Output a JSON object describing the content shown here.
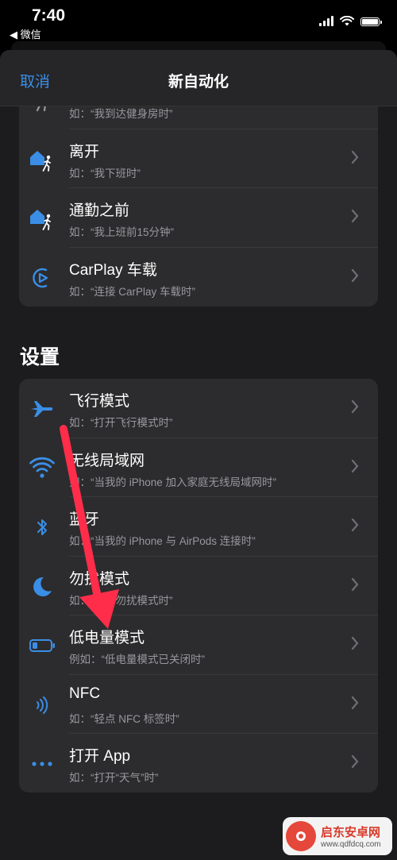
{
  "status": {
    "time": "7:40",
    "back_label": "◀ 微信"
  },
  "nav": {
    "cancel": "取消",
    "title": "新自动化"
  },
  "top_group": [
    {
      "title": "",
      "subtitle": "如：“我到达健身房时”",
      "icon": "person-walking-icon"
    },
    {
      "title": "离开",
      "subtitle": "如：“我下班时”",
      "icon": "house-person-leave-icon"
    },
    {
      "title": "通勤之前",
      "subtitle": "如：“我上班前15分钟”",
      "icon": "house-person-commute-icon"
    },
    {
      "title": "CarPlay 车载",
      "subtitle": "如：“连接 CarPlay 车载时”",
      "icon": "carplay-icon"
    }
  ],
  "settings_section": {
    "title": "设置",
    "items": [
      {
        "title": "飞行模式",
        "subtitle": "如：“打开飞行模式时”",
        "icon": "airplane-icon"
      },
      {
        "title": "无线局域网",
        "subtitle": "如：“当我的 iPhone 加入家庭无线局域网时”",
        "icon": "wifi-icon"
      },
      {
        "title": "蓝牙",
        "subtitle": "如：“当我的 iPhone 与 AirPods 连接时”",
        "icon": "bluetooth-icon"
      },
      {
        "title": "勿扰模式",
        "subtitle": "如：“打开勿扰模式时”",
        "icon": "moon-icon"
      },
      {
        "title": "低电量模式",
        "subtitle": "例如：“低电量模式已关闭时”",
        "icon": "low-battery-icon"
      },
      {
        "title": "NFC",
        "subtitle": "如：“轻点 NFC 标签时”",
        "icon": "nfc-icon"
      },
      {
        "title": "打开 App",
        "subtitle": "如：“打开“天气”时”",
        "icon": "ellipsis-icon"
      }
    ]
  },
  "watermark": {
    "name": "启东安卓网",
    "url": "www.qdfdcq.com"
  },
  "colors": {
    "accent": "#3a8ee6",
    "arrow": "#ff2d4a",
    "row_bg": "#2c2c2e"
  }
}
